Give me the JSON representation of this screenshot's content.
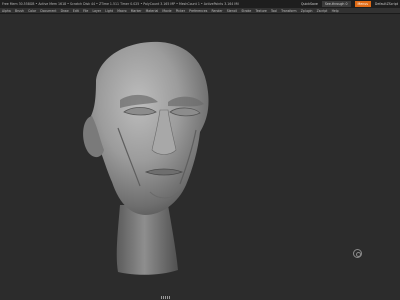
{
  "statusbar": {
    "message": "Free Mem 30.558GB • Active Mem 1618 • Scratch Disk 44 • ZTime 1.511 Timer 0.025 • PolyCount 3.165 MP • MeshCount 1 • ActivePoints 3.164 Mil",
    "quicksave": "QuickSave",
    "seethrough": "See-through 0",
    "menus": "Menus",
    "default_script": "DefaultZScript"
  },
  "menubar": {
    "items": [
      "Alpha",
      "Brush",
      "Color",
      "Document",
      "Draw",
      "Edit",
      "File",
      "Layer",
      "Light",
      "Macro",
      "Marker",
      "Material",
      "Movie",
      "Picker",
      "Preferences",
      "Render",
      "Stencil",
      "Stroke",
      "Texture",
      "Tool",
      "Transform",
      "Zplugin",
      "Zscript",
      "Help"
    ]
  },
  "colors": {
    "background": "#2c2c2c",
    "accent": "#e06b16",
    "clay": "#9b9b9b"
  },
  "icons": {
    "gizmo": "gizmo-icon",
    "handle": "drag-handle-icon"
  }
}
